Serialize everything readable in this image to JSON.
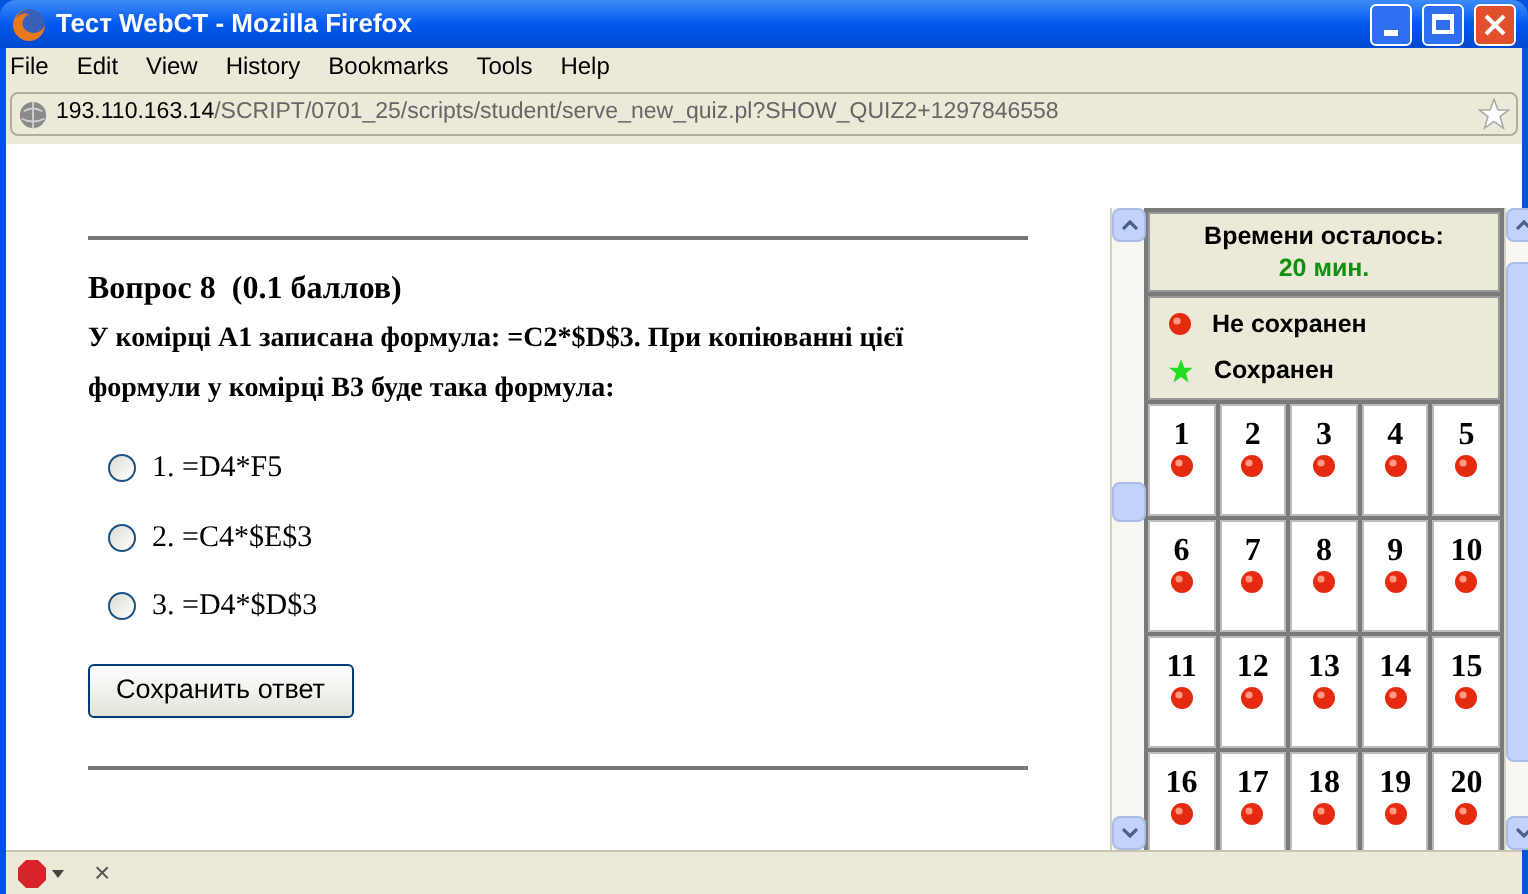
{
  "window": {
    "title": "Тест WebCT - Mozilla Firefox"
  },
  "menu": [
    "File",
    "Edit",
    "View",
    "History",
    "Bookmarks",
    "Tools",
    "Help"
  ],
  "address": {
    "host": "193.110.163.14",
    "path": "/SCRIPT/0701_25/scripts/student/serve_new_quiz.pl?SHOW_QUIZ2+1297846558"
  },
  "question": {
    "heading": "Вопрос 8  (0.1 баллов)",
    "text": "У комірці А1 записана формула: =C2*$D$3. При копіюванні цієї формули у комірці В3 буде така формула:",
    "options": [
      {
        "label": "1. =D4*F5",
        "selected": false
      },
      {
        "label": "2. =C4*$E$3",
        "selected": false
      },
      {
        "label": "3. =D4*$D$3",
        "selected": false
      }
    ],
    "save_button": "Сохранить ответ"
  },
  "sidebar": {
    "time_label": "Времени осталось:",
    "time_value": "20 мин.",
    "legend": [
      {
        "kind": "dot",
        "label": "Не сохранен"
      },
      {
        "kind": "star",
        "label": "Сохранен"
      }
    ],
    "questions": [
      {
        "number": "1",
        "saved": false
      },
      {
        "number": "2",
        "saved": false
      },
      {
        "number": "3",
        "saved": false
      },
      {
        "number": "4",
        "saved": false
      },
      {
        "number": "5",
        "saved": false
      },
      {
        "number": "6",
        "saved": false
      },
      {
        "number": "7",
        "saved": false
      },
      {
        "number": "8",
        "saved": false
      },
      {
        "number": "9",
        "saved": false
      },
      {
        "number": "10",
        "saved": false
      },
      {
        "number": "11",
        "saved": false
      },
      {
        "number": "12",
        "saved": false
      },
      {
        "number": "13",
        "saved": false
      },
      {
        "number": "14",
        "saved": false
      },
      {
        "number": "15",
        "saved": false
      },
      {
        "number": "16",
        "saved": false
      },
      {
        "number": "17",
        "saved": false
      },
      {
        "number": "18",
        "saved": false
      },
      {
        "number": "19",
        "saved": false
      },
      {
        "number": "20",
        "saved": false
      }
    ]
  },
  "status_bar": {
    "close": "×"
  }
}
